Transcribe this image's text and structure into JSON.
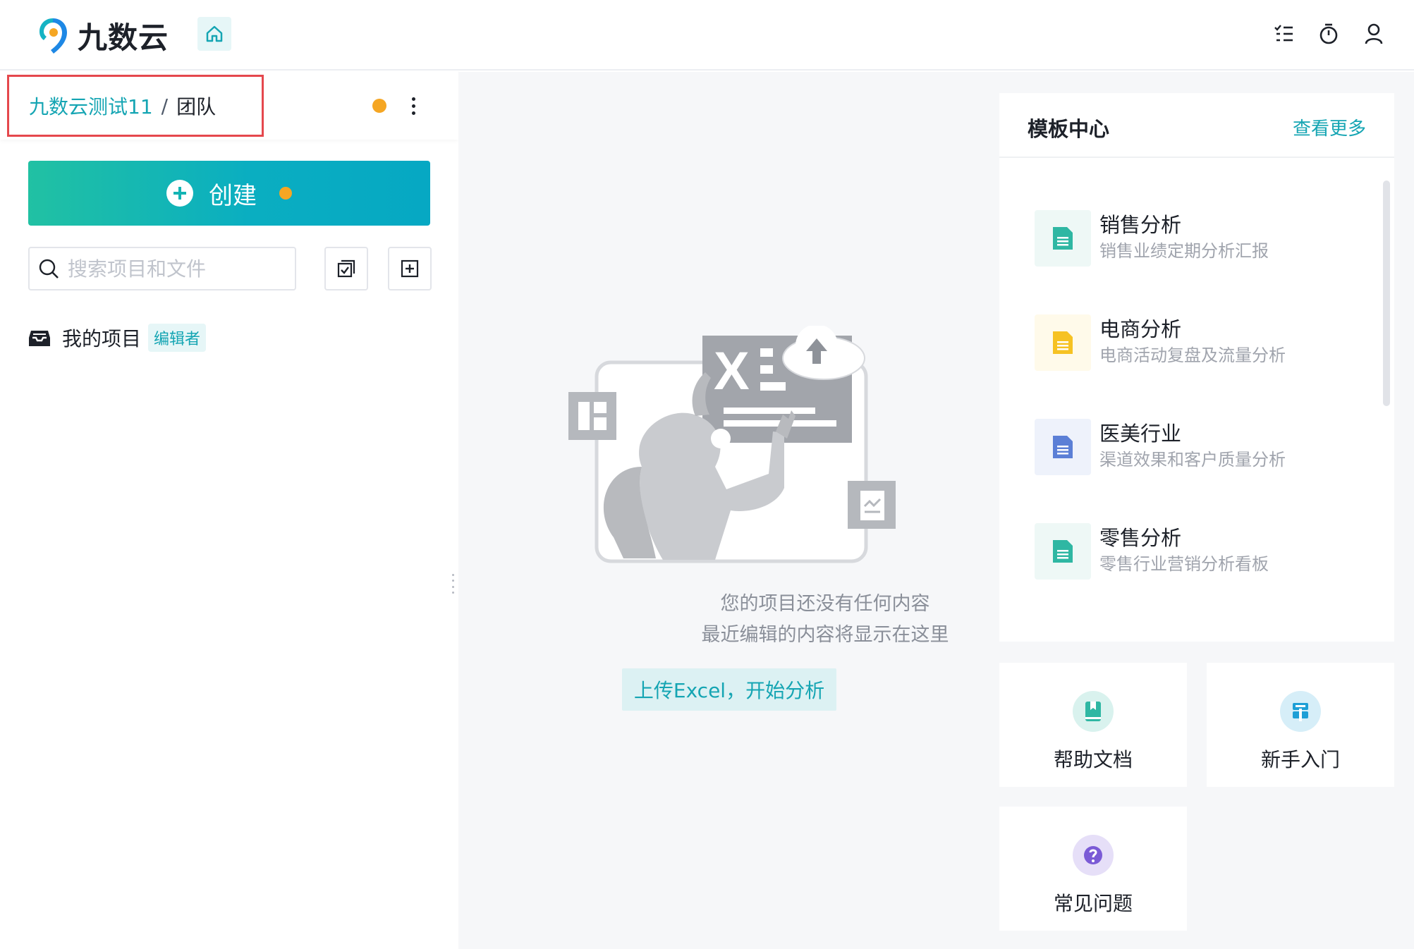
{
  "app": {
    "brand_name": "九数云",
    "brand_colors": {
      "accent": "#15a5b3",
      "orange": "#f5a623",
      "blue": "#1e88e5"
    }
  },
  "topbar": {
    "home_icon": "home-icon",
    "icons": [
      "task-list-icon",
      "timer-icon",
      "user-icon"
    ]
  },
  "sidebar": {
    "team": {
      "workspace": "九数云测试11",
      "separator": "/",
      "current": "团队"
    },
    "create_label": "创建",
    "search": {
      "placeholder": "搜索项目和文件",
      "value": ""
    },
    "my_projects": {
      "label": "我的项目",
      "role_badge": "编辑者"
    }
  },
  "main": {
    "empty_state": {
      "line1": "您的项目还没有任何内容",
      "line2": "最近编辑的内容将显示在这里",
      "upload_label": "上传Excel，开始分析"
    },
    "templates": {
      "title": "模板中心",
      "more_label": "查看更多",
      "items": [
        {
          "name": "销售分析",
          "desc": "销售业绩定期分析汇报",
          "color": "#2fb7a3",
          "bg": "#eef8f6"
        },
        {
          "name": "电商分析",
          "desc": "电商活动复盘及流量分析",
          "color": "#f6c223",
          "bg": "#fffaea"
        },
        {
          "name": "医美行业",
          "desc": "渠道效果和客户质量分析",
          "color": "#5b7fd6",
          "bg": "#eef2fb"
        },
        {
          "name": "零售分析",
          "desc": "零售行业营销分析看板",
          "color": "#2fb7a3",
          "bg": "#eef8f6"
        }
      ]
    },
    "help": [
      {
        "label": "帮助文档",
        "icon": "book-icon",
        "color": "#2fb7a3",
        "bg": "#d9f2ee"
      },
      {
        "label": "新手入门",
        "icon": "signpost-icon",
        "color": "#1e9fd6",
        "bg": "#d6eef8"
      },
      {
        "label": "常见问题",
        "icon": "question-icon",
        "color": "#7b5bd6",
        "bg": "#e6dff8"
      }
    ]
  }
}
